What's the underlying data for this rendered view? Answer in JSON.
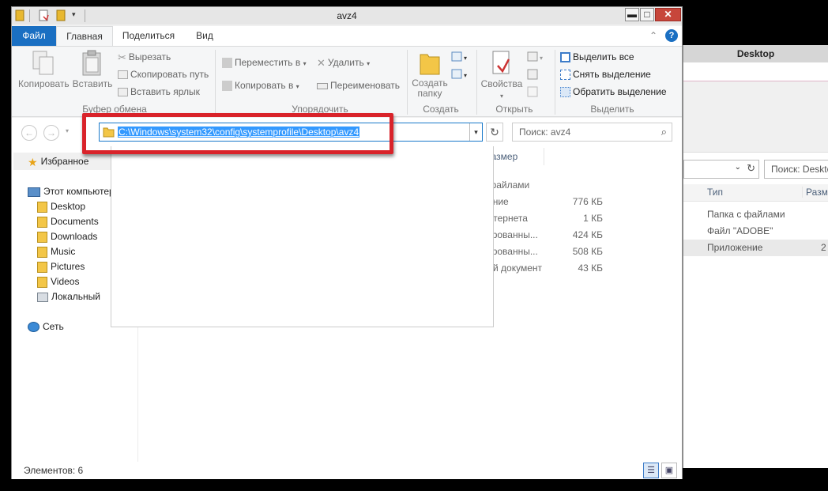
{
  "window": {
    "title": "avz4"
  },
  "title_buttons": {
    "minimize": "▬",
    "maximize": "□",
    "close": "✕"
  },
  "tabs": [
    {
      "label": "Файл"
    },
    {
      "label": "Главная"
    },
    {
      "label": "Поделиться"
    },
    {
      "label": "Вид"
    }
  ],
  "ribbon": {
    "clipboard": {
      "label": "Буфер обмена",
      "copy": "Копировать",
      "paste": "Вставить",
      "cut": "Вырезать",
      "copy_path": "Скопировать путь",
      "paste_shortcut": "Вставить ярлык"
    },
    "organize": {
      "label": "Упорядочить",
      "move_to": "Переместить в",
      "copy_to": "Копировать в",
      "delete": "Удалить",
      "rename": "Переименовать"
    },
    "create": {
      "label": "Создать",
      "new_folder_1": "Создать",
      "new_folder_2": "папку"
    },
    "open": {
      "label": "Открыть",
      "properties": "Свойства"
    },
    "select": {
      "label": "Выделить",
      "select_all": "Выделить все",
      "select_none": "Снять выделение",
      "invert": "Обратить выделение"
    }
  },
  "address": {
    "path": "C:\\Windows\\system32\\config\\systemprofile\\Desktop\\avz4",
    "search_placeholder": "Поиск: avz4"
  },
  "nav": {
    "favorites": "Избранное",
    "this_pc": "Этот компьютер",
    "items": [
      "Desktop",
      "Documents",
      "Downloads",
      "Music",
      "Pictures",
      "Videos",
      "Локальный"
    ],
    "network": "Сеть"
  },
  "columns": {
    "size": "Размер"
  },
  "files": [
    {
      "type": "с файлами",
      "size": ""
    },
    {
      "type": "жение",
      "size": "776 КБ"
    },
    {
      "type": "Интернета",
      "size": "1 КБ"
    },
    {
      "type": "лированны...",
      "size": "424 КБ"
    },
    {
      "type": "лированны...",
      "size": "508 КБ"
    },
    {
      "type": "вый документ",
      "size": "43 КБ"
    }
  ],
  "status": {
    "items": "Элементов: 6"
  },
  "bg_window": {
    "title": "Desktop",
    "search": "Поиск: Deskto",
    "col_type": "Тип",
    "col_size": "Разме",
    "rows": [
      {
        "type": "Папка с файлами",
        "size": ""
      },
      {
        "type": "Файл \"ADOBE\"",
        "size": ""
      },
      {
        "type": "Приложение",
        "size": "2"
      }
    ]
  }
}
